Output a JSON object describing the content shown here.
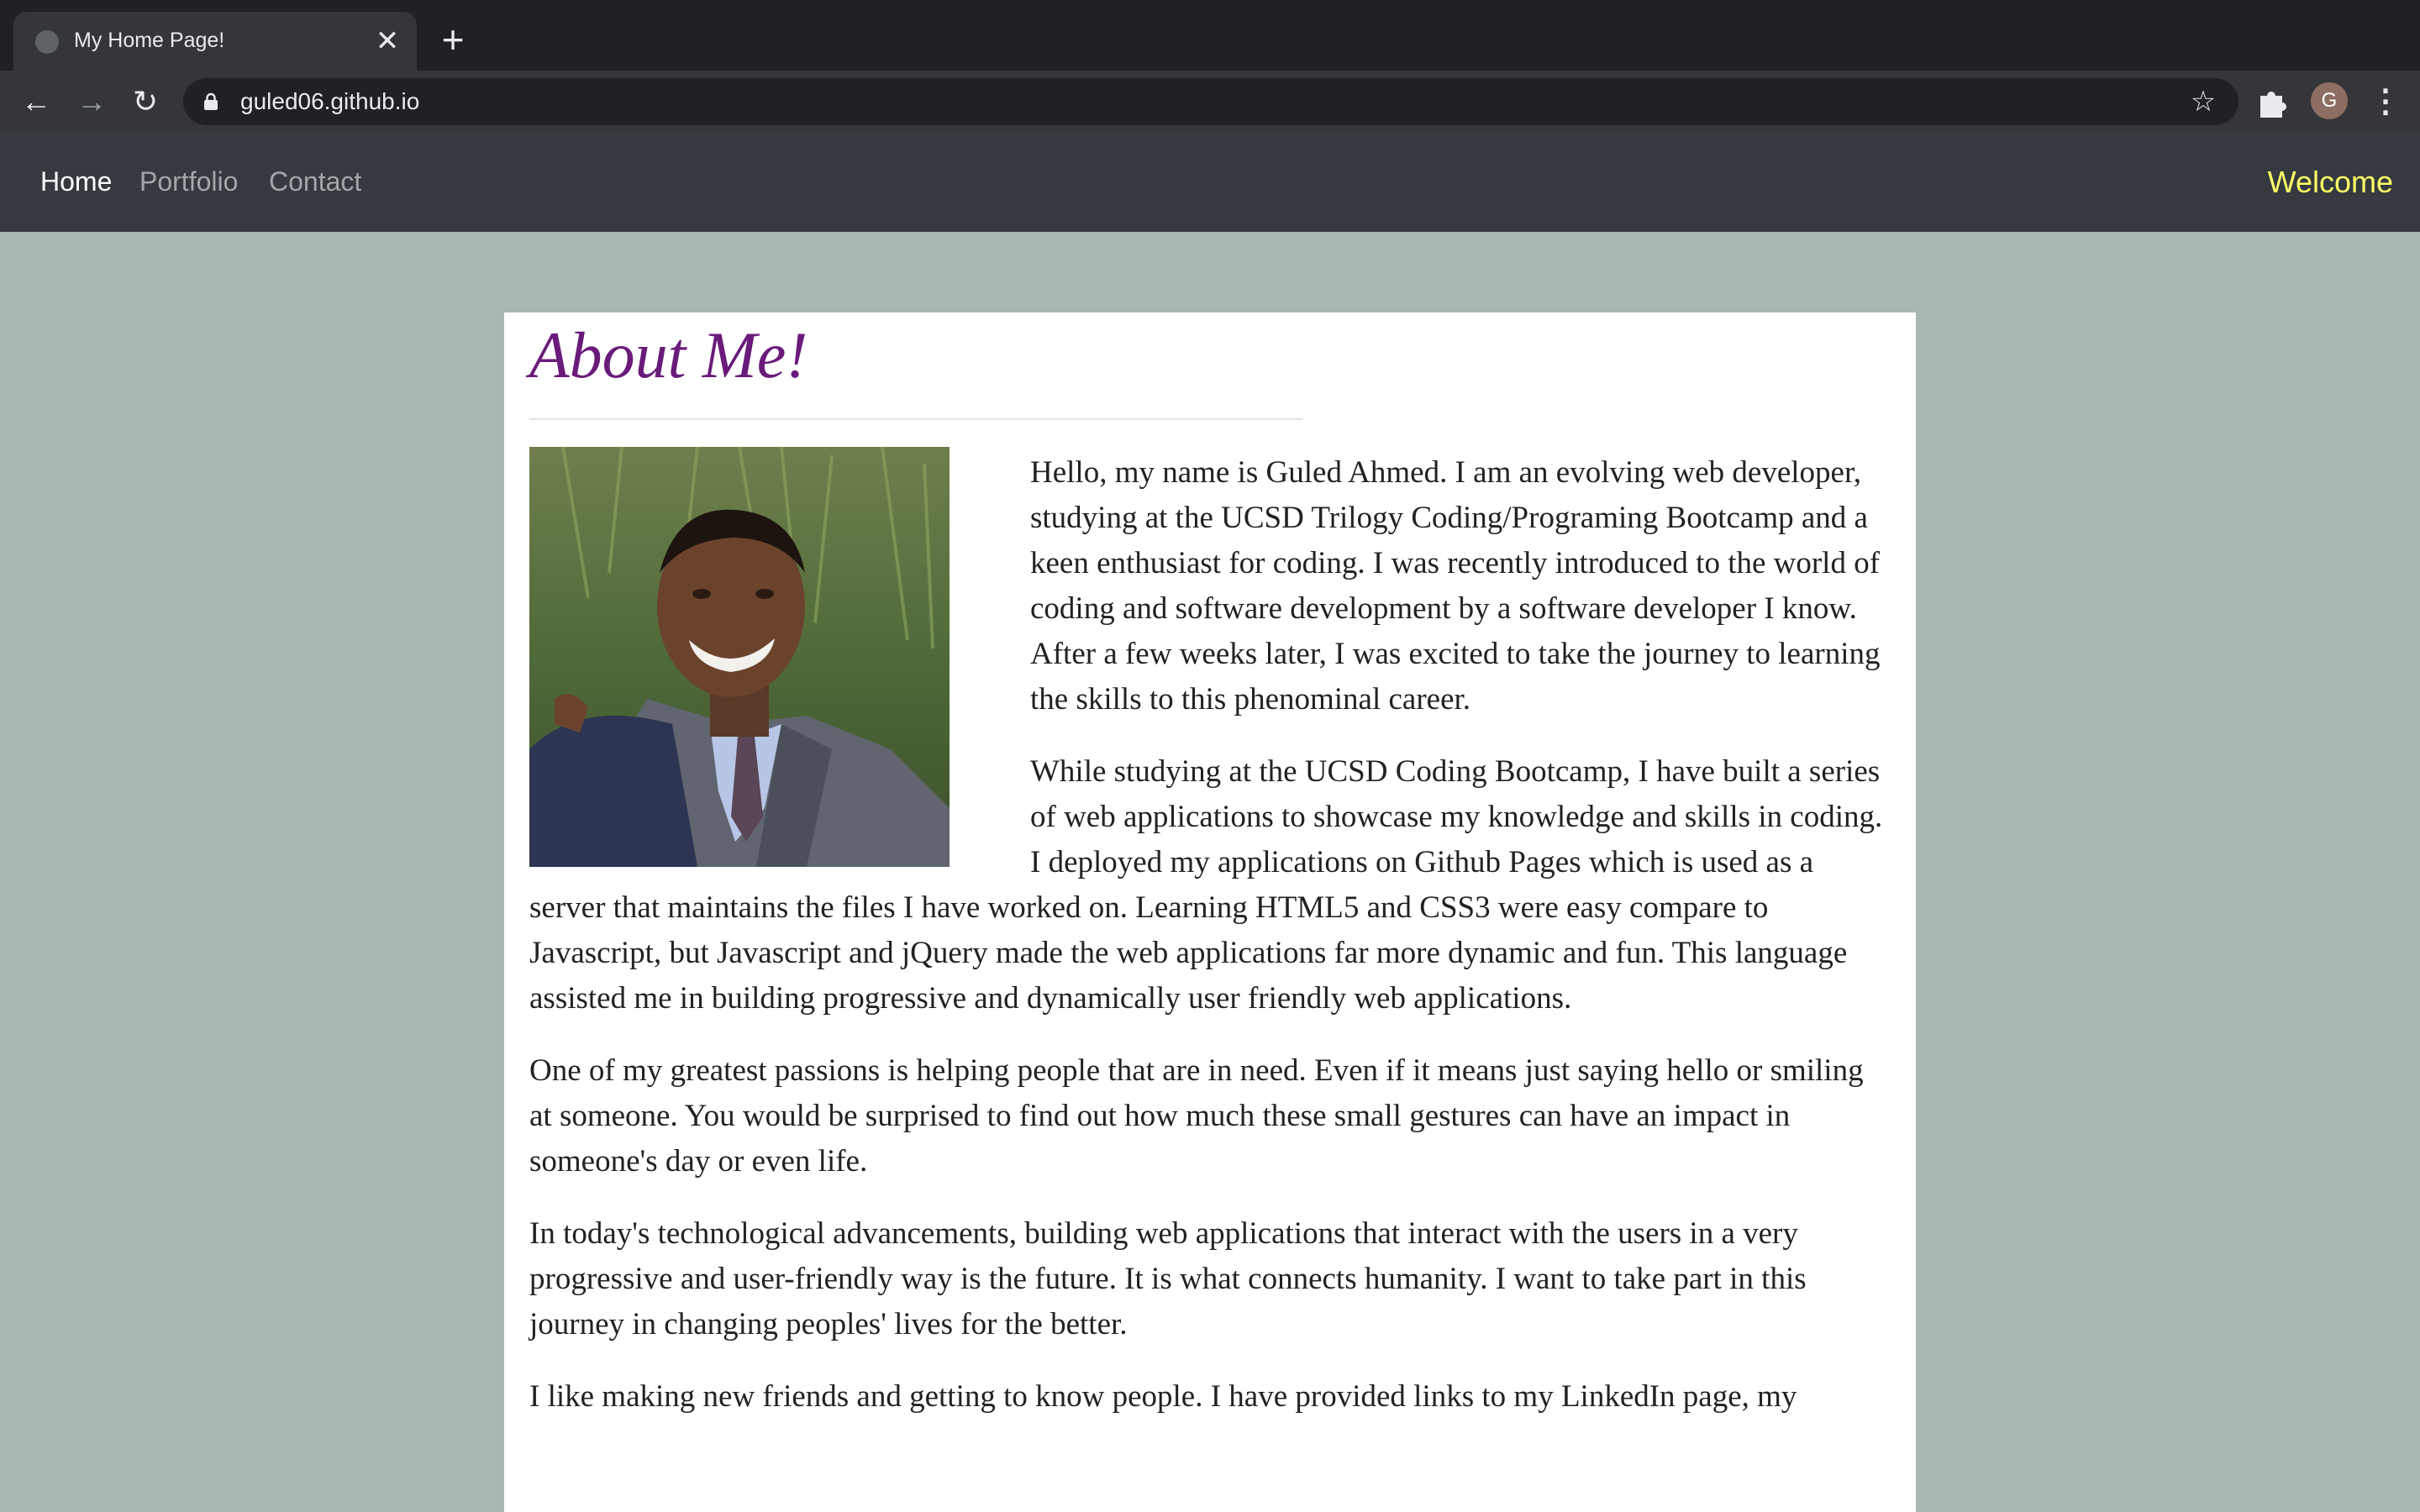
{
  "browser": {
    "tab_title": "My Home Page!",
    "tab_close": "✕",
    "new_tab": "+",
    "url": "guled06.github.io",
    "back": "←",
    "forward": "→",
    "reload": "↻",
    "star": "☆",
    "avatar_initial": "G",
    "menu": "⋮"
  },
  "navbar": {
    "links": [
      "Home",
      "Portfolio",
      "Contact"
    ],
    "active": "Home",
    "welcome": "Welcome"
  },
  "about": {
    "title": "About Me!",
    "paragraphs": [
      "Hello, my name is Guled Ahmed. I am an evolving web developer, studying at the UCSD Trilogy Coding/Programing Bootcamp and a keen enthusiast for coding. I was recently introduced to the world of coding and software development by a software developer I know. After a few weeks later, I was excited to take the journey to learning the skills to this phenominal career.",
      "While studying at the UCSD Coding Bootcamp, I have built a series of web applications to showcase my knowledge and skills in coding. I deployed my applications on Github Pages which is used as a server that maintains the files I have worked on. Learning HTML5 and CSS3 were easy compare to Javascript, but Javascript and jQuery made the web applications far more dynamic and fun. This language assisted me in building progressive and dynamically user friendly web applications.",
      "One of my greatest passions is helping people that are in need. Even if it means just saying hello or smiling at someone. You would be surprised to find out how much these small gestures can have an impact in someone's day or even life.",
      "In today's technological advancements, building web applications that interact with the users in a very progressive and user-friendly way is the future. It is what connects humanity. I want to take part in this journey in changing peoples' lives for the better.",
      "I like making new friends and getting to know people. I have provided links to my LinkedIn page, my"
    ]
  },
  "colors": {
    "page_bg": "#a9b6b3",
    "navbar_bg": "#343a40",
    "welcome": "#ffff66",
    "title": "#6a1b7a"
  },
  "icons": {
    "favicon": "globe-icon",
    "lock": "lock-icon",
    "extensions": "puzzle-icon"
  }
}
